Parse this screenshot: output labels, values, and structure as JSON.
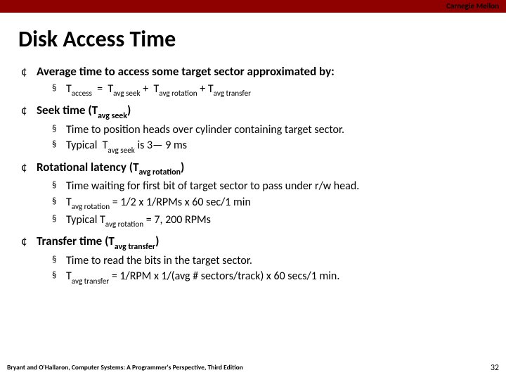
{
  "header": {
    "brand": "Carnegie Mellon"
  },
  "title": "Disk Access Time",
  "items": [
    {
      "head": "Average time to access some target sector approximated by:",
      "subs": [
        {
          "html": "T<span class='sub'>access</span>&nbsp; =&nbsp; T<span class='sub'>avg seek</span> +&nbsp; T<span class='sub'>avg rotation</span> + T<span class='sub'>avg transfer</span>"
        }
      ]
    },
    {
      "head_html": "Seek time (T<span class='sub'>avg seek</span>)",
      "subs": [
        {
          "text": "Time to position heads over cylinder containing target sector."
        },
        {
          "html": "Typical&nbsp; T<span class='sub'>avg seek</span> is 3— 9 ms"
        }
      ]
    },
    {
      "head_html": "Rotational latency (T<span class='sub'>avg rotation</span>)",
      "subs": [
        {
          "text": "Time waiting for first bit of target sector to pass under r/w head."
        },
        {
          "html": "T<span class='sub'>avg rotation</span> = 1/2 x 1/RPMs x 60 sec/1 min"
        },
        {
          "html": "Typical T<span class='sub'>avg rotation</span> = 7, 200 RPMs"
        }
      ]
    },
    {
      "head_html": "Transfer time (T<span class='sub'>avg transfer</span>)",
      "subs": [
        {
          "text": "Time to read the bits in the target sector."
        },
        {
          "html": "T<span class='sub'>avg transfer</span> = 1/RPM x 1/(avg # sectors/track) x 60 secs/1 min."
        }
      ]
    }
  ],
  "footer": {
    "citation": "Bryant and O'Hallaron, Computer Systems: A Programmer's Perspective, Third Edition",
    "page": "32"
  }
}
